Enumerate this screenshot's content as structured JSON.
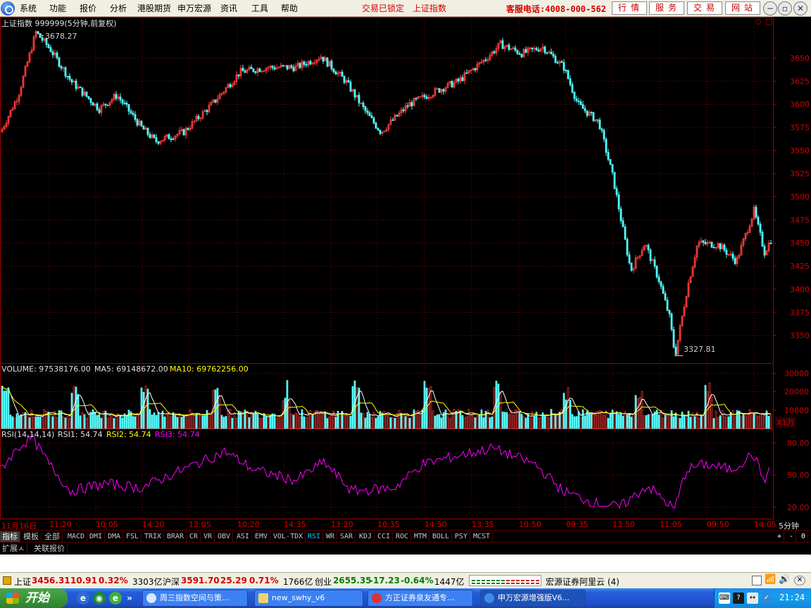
{
  "menu": {
    "items": [
      "系统",
      "功能",
      "报价",
      "分析",
      "港股期货",
      "申万宏源",
      "资讯",
      "工具",
      "帮助"
    ],
    "status_locked": "交易已锁定",
    "current_index": "上证指数",
    "hotline": "客服电话:4008-000-562",
    "nav_buttons": [
      "行情",
      "服务",
      "交易",
      "网站"
    ]
  },
  "chart": {
    "title": "上证指数 999999(5分钟,前复权)",
    "high_label": "3678.27",
    "low_label": "3327.81",
    "y_ticks": [
      "3650",
      "3625",
      "3600",
      "3575",
      "3550",
      "3525",
      "3500",
      "3475",
      "3450",
      "3425",
      "3400",
      "3375",
      "3350"
    ],
    "corner_icons": [
      "◇",
      "□"
    ]
  },
  "volume": {
    "label": "VOLUME: 97538176.00",
    "ma5": "MA5: 69148672.00",
    "ma10": "MA10: 69762256.00",
    "y_ticks": [
      "30000",
      "20000",
      "10000"
    ],
    "unit": "X1万"
  },
  "rsi": {
    "label": "RSI(14,14,14)",
    "rsi1": "RSI1: 54.74",
    "rsi2": "RSI2: 54.74",
    "rsi3": "RSI3: 54.74",
    "y_ticks": [
      "80.00",
      "50.00",
      "20.00"
    ]
  },
  "time_axis": {
    "labels": [
      "11月16日",
      "11:20",
      "10:05",
      "14:20",
      "13:05",
      "10:20",
      "14:35",
      "13:20",
      "10:35",
      "14:50",
      "13:35",
      "10:50",
      "09:35",
      "13:50",
      "11:05",
      "09:50",
      "14:05"
    ],
    "period": "5分钟"
  },
  "tabs": {
    "categories": [
      "指标",
      "模板",
      "全部"
    ],
    "indicators": [
      "MACD",
      "DMI",
      "DMA",
      "FSL",
      "TRIX",
      "BRAR",
      "CR",
      "VR",
      "OBV",
      "ASI",
      "EMV",
      "VOL-TDX",
      "RSI",
      "WR",
      "SAR",
      "KDJ",
      "CCI",
      "ROC",
      "MTM",
      "BOLL",
      "PSY",
      "MCST"
    ],
    "active_indicator": "RSI",
    "controls": [
      "+",
      "-",
      "0"
    ],
    "extra": [
      "扩展ㅅ",
      "关联报价"
    ]
  },
  "statusbar": {
    "sh_name": "上证",
    "sh_value": "3456.31",
    "sh_change": "10.91",
    "sh_pct": "0.32%",
    "sh_amount": "3303亿",
    "hs_name": "沪深",
    "hs_value": "3591.70",
    "hs_change": "25.29",
    "hs_pct": "0.71%",
    "hs_amount": "1766亿",
    "cy_name": "创业",
    "cy_value": "2655.35",
    "cy_change": "-17.23",
    "cy_pct": "-0.64%",
    "cy_amount": "1447亿",
    "server": "宏源证券阿里云 (4)"
  },
  "taskbar": {
    "start": "开始",
    "tasks": [
      "周三指数空间与策...",
      "new_swhy_v6",
      "方正证券泉友通专...",
      "申万宏源增强版V6..."
    ],
    "clock": "21:24"
  },
  "colors": {
    "up": "#ff3c3c",
    "down": "#54ffff",
    "ma5": "#ffffff",
    "ma10": "#ffff00",
    "rsi": "#ff00ff",
    "grid": "#8b0000"
  }
}
